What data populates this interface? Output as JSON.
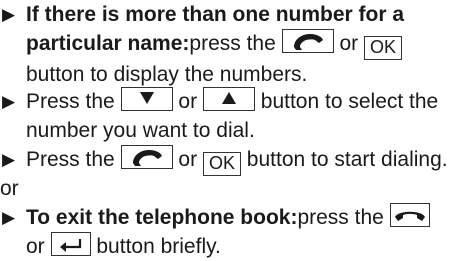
{
  "steps": [
    {
      "lead": "If there is more than one number for a particular name:",
      "before": "press the",
      "or": "or",
      "ok_label": "OK",
      "after": "button to display the numbers."
    },
    {
      "before": "Press the",
      "or": "or",
      "after": "button to select the number you want to dial."
    },
    {
      "before": "Press the",
      "or": "or",
      "ok_label": "OK",
      "after": "button to start dialing."
    },
    {
      "lead": "To exit the telephone book:",
      "before": "press the",
      "or": "or",
      "after": "button briefly."
    }
  ],
  "separator": "or",
  "icons": {
    "bullet": "triangle-right-icon",
    "call": "phone-handset-icon",
    "down": "arrow-down-icon",
    "up": "arrow-up-icon",
    "hangup": "hang-up-icon",
    "back": "back-arrow-icon"
  }
}
